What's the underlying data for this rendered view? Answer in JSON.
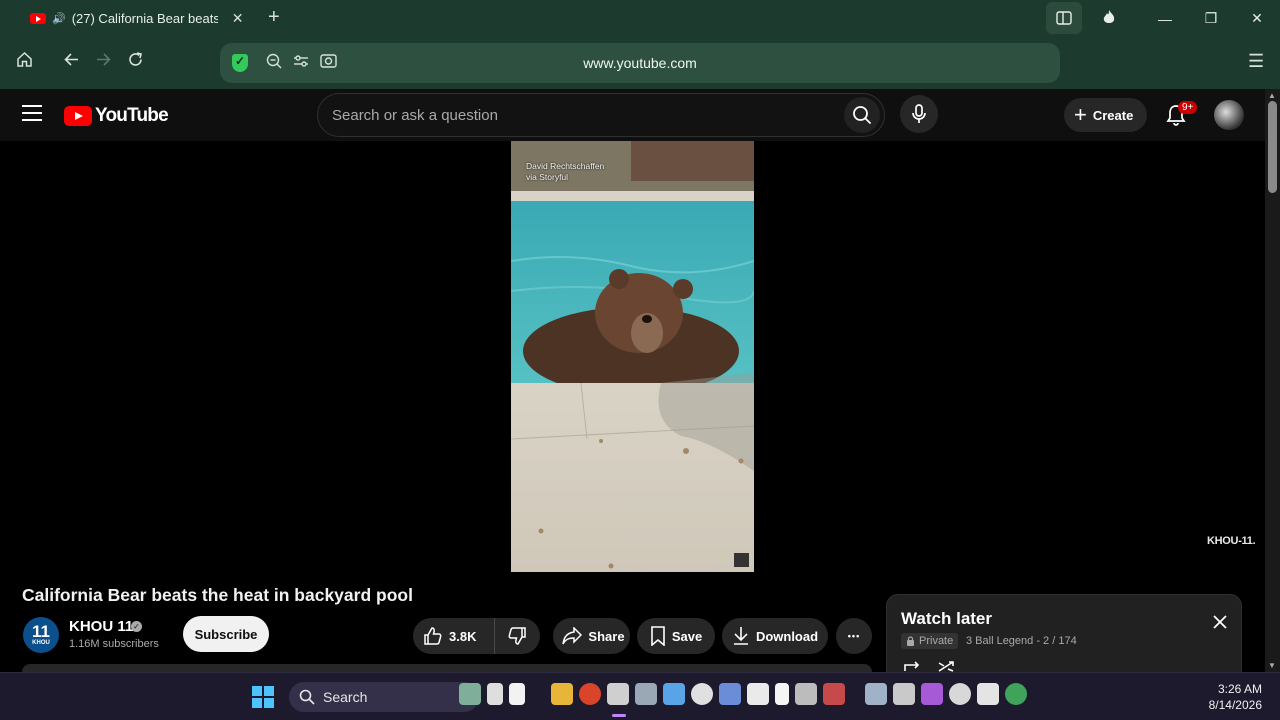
{
  "browser": {
    "tab_title": "(27) California Bear beats the heat in backyard pool",
    "tab_close": "✕",
    "new_tab": "+",
    "url": "www.youtube.com"
  },
  "youtube": {
    "logo_text": "YouTube",
    "search_placeholder": "Search or ask a question",
    "create_label": "Create",
    "notification_badge": "9+"
  },
  "video": {
    "credit_line1": "David Rechtschaffen",
    "credit_line2": "via Storyful",
    "watermark": "KHOU-11.",
    "title": "California Bear beats the heat in backyard pool"
  },
  "channel": {
    "avatar_number": "11",
    "avatar_letters": "KHOU",
    "name": "KHOU 11",
    "subscribers": "1.16M subscribers",
    "subscribe_label": "Subscribe"
  },
  "actions": {
    "likes": "3.8K",
    "share": "Share",
    "save": "Save",
    "download": "Download",
    "more": "•••"
  },
  "playlist": {
    "title": "Watch later",
    "privacy": "Private",
    "meta": "3 Ball Legend - 2 / 174"
  },
  "taskbar": {
    "search_label": "Search",
    "time": "3:26 AM",
    "date": "8/14/2026"
  },
  "colors": {
    "browser_chrome": "#1c3a2d",
    "yt_red": "#ff0000",
    "yt_bg": "#0f0f0f",
    "taskbar": "#1d1a2e"
  }
}
